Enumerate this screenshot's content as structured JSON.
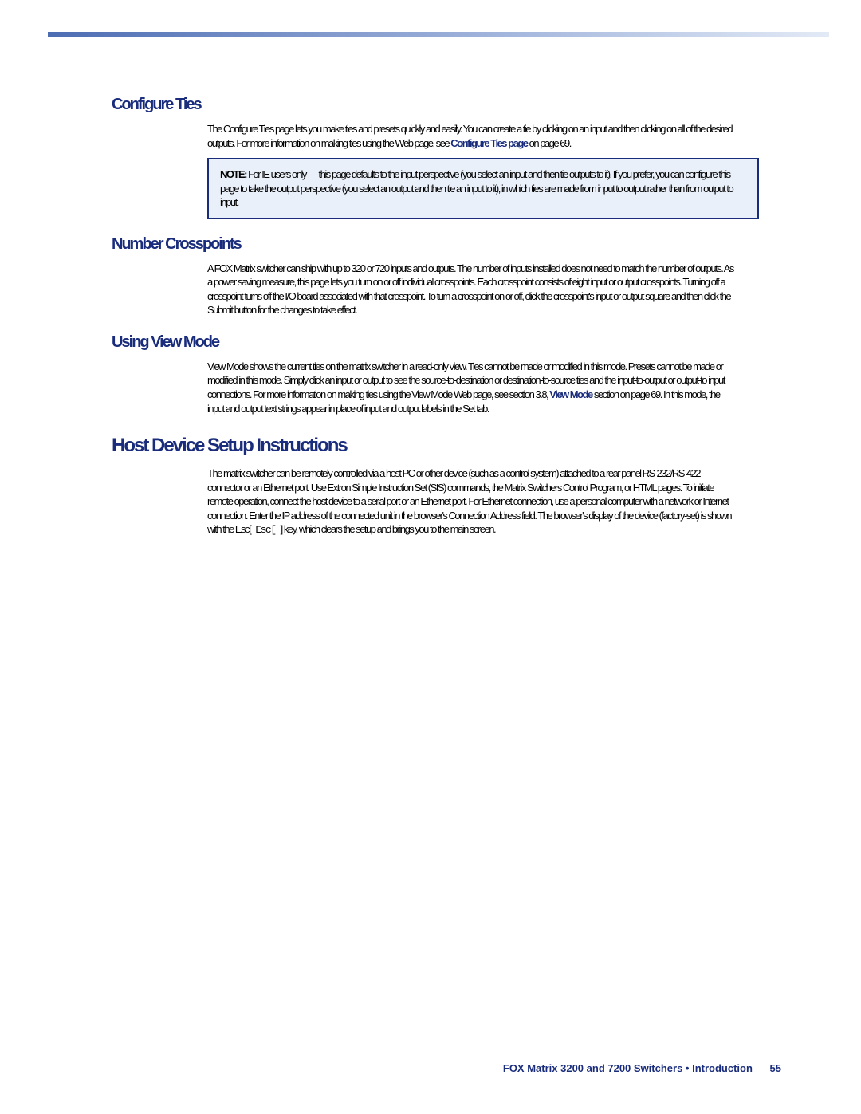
{
  "sections": {
    "configure": {
      "heading": "Configure Ties",
      "body_before_link": "The Configure Ties page lets you make ties and presets quickly and easily. You can create a tie by clicking on an input and then clicking on all of the desired outputs. For more information on making ties using the Web page, see ",
      "link_text": "Configure Ties page",
      "body_after_link": " on page 69."
    },
    "note": {
      "label": "NOTE:",
      "text": " For IE users only — this page defaults to the input perspective (you select an input and then tie outputs to it). If you prefer, you can configure this page to take the output perspective (you select an output and then tie an input to it), in which ties are made from input to output rather than from output to input."
    },
    "number_crosspoints": {
      "heading": "Number Crosspoints",
      "body": "A FOX Matrix switcher can ship with up to 320 or 720 inputs and outputs. The number of inputs installed does not need to match the number of outputs. As a power saving measure, this page lets you turn on or off individual crosspoints. Each crosspoint consists of eight input or output crosspoints. Turning off a crosspoint turns off the I/O board associated with that crosspoint. To turn a crosspoint on or off, click the crosspoint's input or output square and then click the Submit button for the changes to take effect."
    },
    "viewmode": {
      "heading": "Using View Mode",
      "body_before_link": "View Mode shows the current ties on the matrix switcher in a read-only view. Ties cannot be made or modified in this mode. Presets cannot be made or modified in this mode. Simply click an input or output to see the source-to-destination or destination-to-source ties and the input-to-output or output-to input connections. For more information on making ties using the View Mode Web page, see section 3.8, ",
      "link_text": "View Mode",
      "body_after_link": " section on page 69. In this mode, the input and output text strings appear in place of input and output labels in the Set tab."
    },
    "host_setup": {
      "heading": "Host Device Setup Instructions",
      "body_before_kbd": "The matrix switcher can be remotely controlled via a host PC or other device (such as a control system) attached to a rear panel RS-232/RS-422 connector or an Ethernet port. Use Extron Simple Instruction Set (SIS) commands, the Matrix Switchers Control Program, or HTML pages. To initiate remote operation, connect the host device to a serial port or an Ethernet port. For Ethernet connection, use a personal computer with a network or Internet connection. Enter the IP address of the connected unit in the browser's Connection Address field. The browser's display of the device (factory-set) is shown with the Esc[ ",
      "kbd": "Esc[",
      "body_after_kbd": " ] key, which clears the setup and brings you to the main screen."
    }
  },
  "footer": {
    "text": "FOX Matrix 3200 and 7200 Switchers • Introduction",
    "page": "55"
  }
}
